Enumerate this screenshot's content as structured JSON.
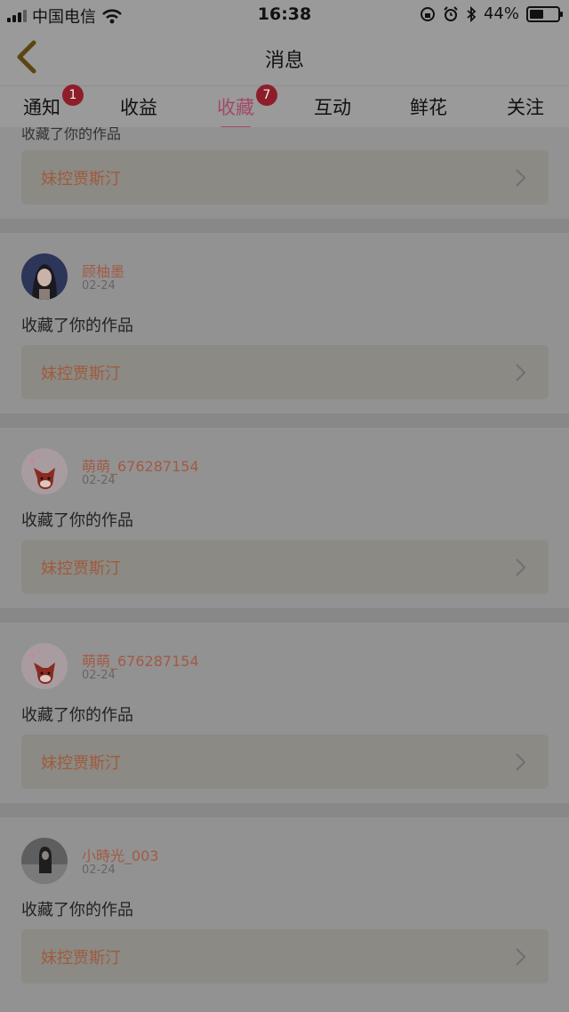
{
  "status_bar": {
    "carrier": "中国电信",
    "time": "16:38",
    "battery": "44%",
    "battery_level": 0.44
  },
  "nav": {
    "title": "消息"
  },
  "tabs": [
    {
      "label": "通知",
      "badge": "1",
      "active": false
    },
    {
      "label": "收益",
      "badge": "",
      "active": false
    },
    {
      "label": "收藏",
      "badge": "7",
      "active": true
    },
    {
      "label": "互动",
      "badge": "",
      "active": false
    },
    {
      "label": "鲜花",
      "badge": "",
      "active": false
    },
    {
      "label": "关注",
      "badge": "",
      "active": false
    }
  ],
  "feed": {
    "partial_item": {
      "action": "收藏了你的作品",
      "work_title": "妹控贾斯汀"
    },
    "items": [
      {
        "username": "顾柚墨",
        "date": "02-24",
        "action": "收藏了你的作品",
        "work_title": "妹控贾斯汀",
        "avatar": "girl-portrait-avatar"
      },
      {
        "username": "萌萌_676287154",
        "date": "02-24",
        "action": "收藏了你的作品",
        "work_title": "妹控贾斯汀",
        "avatar": "red-fox-avatar"
      },
      {
        "username": "萌萌_676287154",
        "date": "02-24",
        "action": "收藏了你的作品",
        "work_title": "妹控贾斯汀",
        "avatar": "red-fox-avatar"
      },
      {
        "username": "小時光_003",
        "date": "02-24",
        "action": "收藏了你的作品",
        "work_title": "妹控贾斯汀",
        "avatar": "dark-photo-avatar"
      }
    ]
  }
}
